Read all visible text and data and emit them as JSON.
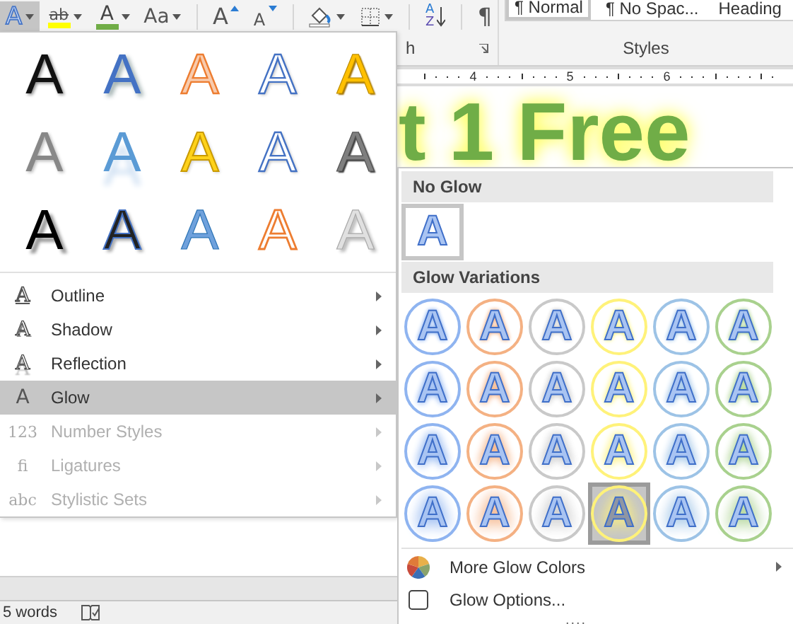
{
  "toolbar": [
    {
      "kind": "text-effects",
      "glyph": "A",
      "dropdown": true,
      "selected": true
    },
    {
      "kind": "highlight",
      "glyph": "ab",
      "dropdown": true,
      "selected": false,
      "color": "#ffff00"
    },
    {
      "kind": "font-color",
      "glyph": "A",
      "dropdown": true,
      "selected": false,
      "color": "#70ad47"
    },
    {
      "kind": "change-case",
      "glyph": "Aa",
      "dropdown": true,
      "selected": false
    },
    {
      "kind": "grow",
      "glyph": "A",
      "dropdown": false,
      "selected": false
    },
    {
      "kind": "shrink",
      "glyph": "A",
      "dropdown": false,
      "selected": false
    },
    {
      "kind": "shading",
      "dropdown": true,
      "selected": false
    },
    {
      "kind": "borders",
      "dropdown": true,
      "selected": false
    },
    {
      "kind": "sort",
      "glyph": "A",
      "glyph2": "Z",
      "dropdown": false,
      "selected": false
    },
    {
      "kind": "pilcrow",
      "glyph": "¶",
      "dropdown": false,
      "selected": false
    }
  ],
  "paragraph_group": {
    "label": "h"
  },
  "styles": {
    "label": "Styles",
    "items": [
      {
        "label": "¶ Normal",
        "selected": true
      },
      {
        "label": "¶ No Spac...",
        "selected": false
      },
      {
        "label": "Heading",
        "selected": false
      }
    ]
  },
  "ruler": {
    "numbers": [
      "4",
      "5",
      "6"
    ]
  },
  "document": {
    "heading": "t 1 Free"
  },
  "status_bar": {
    "words": "5 words"
  },
  "effects_menu": {
    "gallery": [
      [
        {
          "letter": "A",
          "kind": "plain"
        },
        {
          "letter": "A",
          "kind": "blue-shadow"
        },
        {
          "letter": "A",
          "kind": "orange"
        },
        {
          "letter": "A",
          "kind": "outline-blue"
        },
        {
          "letter": "A",
          "kind": "gold"
        }
      ],
      [
        {
          "letter": "A",
          "kind": "grey"
        },
        {
          "letter": "A",
          "kind": "blue-reflect"
        },
        {
          "letter": "A",
          "kind": "yellow"
        },
        {
          "letter": "A",
          "kind": "outline-blue"
        },
        {
          "letter": "A",
          "kind": "dark-bevel"
        }
      ],
      [
        {
          "letter": "A",
          "kind": "black-shadow"
        },
        {
          "letter": "A",
          "kind": "black-blue"
        },
        {
          "letter": "A",
          "kind": "blue-gradient"
        },
        {
          "letter": "A",
          "kind": "outline-orange"
        },
        {
          "letter": "A",
          "kind": "silver"
        }
      ]
    ],
    "items": [
      {
        "icon": "A",
        "kind": "outline",
        "label": "Outline",
        "selected": false,
        "disabled": false
      },
      {
        "icon": "A",
        "kind": "shadow",
        "label": "Shadow",
        "selected": false,
        "disabled": false
      },
      {
        "icon": "A",
        "kind": "reflection",
        "label": "Reflection",
        "selected": false,
        "disabled": false
      },
      {
        "icon": "A",
        "kind": "glow",
        "label": "Glow",
        "selected": true,
        "disabled": false
      },
      {
        "icon": "123",
        "kind": "numbers",
        "label": "Number Styles",
        "selected": false,
        "disabled": true
      },
      {
        "icon": "fi",
        "kind": "ligature",
        "label": "Ligatures",
        "selected": false,
        "disabled": true
      },
      {
        "icon": "abc",
        "kind": "stylistic",
        "label": "Stylistic Sets",
        "selected": false,
        "disabled": true
      }
    ]
  },
  "glow_menu": {
    "no_glow": {
      "heading": "No Glow",
      "letter": "A",
      "selected": true
    },
    "variations_heading": "Glow Variations",
    "rows": [
      [
        {
          "letter": "A",
          "color": "#8fb4f0",
          "hovered": false
        },
        {
          "letter": "A",
          "color": "#f4b183",
          "hovered": false
        },
        {
          "letter": "A",
          "color": "#c9c9c9",
          "hovered": false
        },
        {
          "letter": "A",
          "color": "#fff27a",
          "hovered": false
        },
        {
          "letter": "A",
          "color": "#9dc3e6",
          "hovered": false
        },
        {
          "letter": "A",
          "color": "#a9d18e",
          "hovered": false
        }
      ],
      [
        {
          "letter": "A",
          "color": "#8fb4f0",
          "hovered": false
        },
        {
          "letter": "A",
          "color": "#f4b183",
          "hovered": false
        },
        {
          "letter": "A",
          "color": "#c9c9c9",
          "hovered": false
        },
        {
          "letter": "A",
          "color": "#fff27a",
          "hovered": false
        },
        {
          "letter": "A",
          "color": "#9dc3e6",
          "hovered": false
        },
        {
          "letter": "A",
          "color": "#a9d18e",
          "hovered": false
        }
      ],
      [
        {
          "letter": "A",
          "color": "#8fb4f0",
          "hovered": false
        },
        {
          "letter": "A",
          "color": "#f4b183",
          "hovered": false
        },
        {
          "letter": "A",
          "color": "#c9c9c9",
          "hovered": false
        },
        {
          "letter": "A",
          "color": "#fff27a",
          "hovered": false
        },
        {
          "letter": "A",
          "color": "#9dc3e6",
          "hovered": false
        },
        {
          "letter": "A",
          "color": "#a9d18e",
          "hovered": false
        }
      ],
      [
        {
          "letter": "A",
          "color": "#8fb4f0",
          "hovered": false
        },
        {
          "letter": "A",
          "color": "#f4b183",
          "hovered": false
        },
        {
          "letter": "A",
          "color": "#c9c9c9",
          "hovered": false
        },
        {
          "letter": "A",
          "color": "#fff27a",
          "hovered": true
        },
        {
          "letter": "A",
          "color": "#9dc3e6",
          "hovered": false
        },
        {
          "letter": "A",
          "color": "#a9d18e",
          "hovered": false
        }
      ]
    ],
    "actions": [
      {
        "kind": "colors",
        "label": "More Glow Colors",
        "submenu": true
      },
      {
        "kind": "options",
        "label": "Glow Options...",
        "submenu": false
      }
    ],
    "grip": "...."
  }
}
